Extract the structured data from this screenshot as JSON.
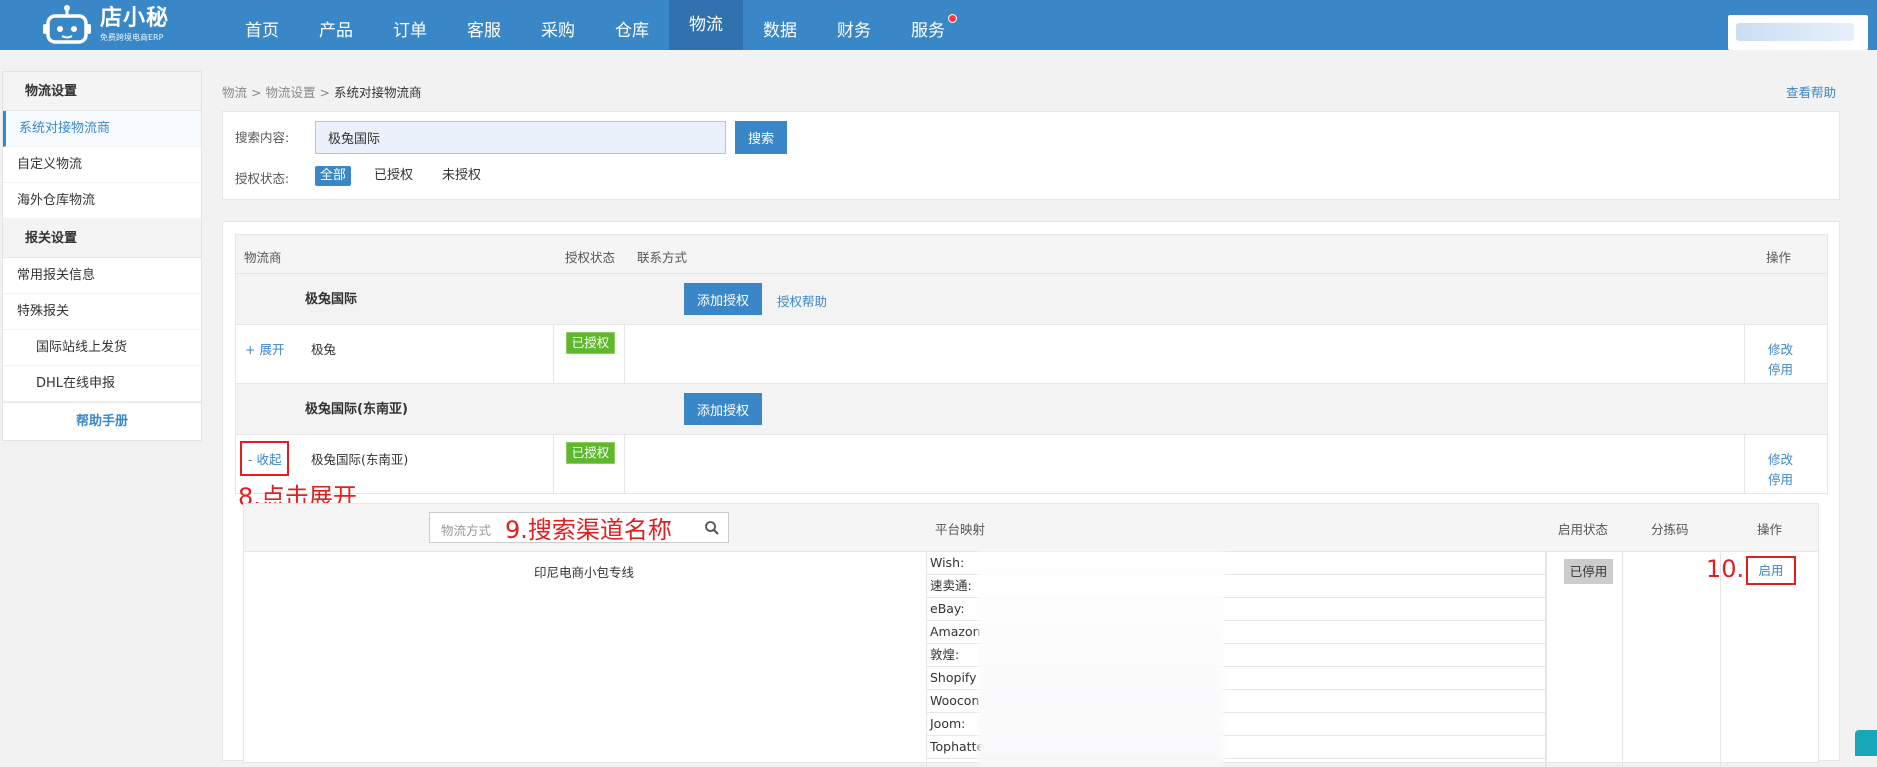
{
  "logo": {
    "name": "店小秘",
    "subtitle": "免费跨境电商ERP",
    "icon": "robot-logo-icon"
  },
  "nav": {
    "items": [
      {
        "label": "首页"
      },
      {
        "label": "产品"
      },
      {
        "label": "订单"
      },
      {
        "label": "客服"
      },
      {
        "label": "采购"
      },
      {
        "label": "仓库"
      },
      {
        "label": "物流",
        "active": true
      },
      {
        "label": "数据"
      },
      {
        "label": "财务"
      },
      {
        "label": "服务",
        "notification_dot": true
      }
    ],
    "accent": "#3a87c8"
  },
  "sidebar": {
    "group1": "物流设置",
    "items1": [
      "系统对接物流商",
      "自定义物流",
      "海外仓库物流"
    ],
    "group2": "报关设置",
    "items2": [
      "常用报关信息",
      "特殊报关",
      "国际站线上发货",
      "DHL在线申报"
    ],
    "help": "帮助手册"
  },
  "breadcrumb": {
    "a": "物流",
    "sep": ">",
    "b": "物流设置",
    "c": "系统对接物流商"
  },
  "help_link": "查看帮助",
  "search": {
    "label": "搜索内容:",
    "value": "极兔国际",
    "button": "搜索",
    "status_label": "授权状态:",
    "filters": [
      "全部",
      "已授权",
      "未授权"
    ]
  },
  "table": {
    "headers": {
      "carrier": "物流商",
      "auth": "授权状态",
      "contact": "联系方式",
      "ops": "操作"
    },
    "groups": [
      {
        "name": "极兔国际",
        "add_auth": "添加授权",
        "auth_help": "授权帮助",
        "row": {
          "toggle": "+ 展开",
          "name": "极兔",
          "status": "已授权",
          "edit": "修改",
          "disable": "停用"
        }
      },
      {
        "name": "极兔国际(东南亚)",
        "add_auth": "添加授权",
        "row": {
          "toggle": "- 收起",
          "name": "极兔国际(东南亚)",
          "status": "已授权",
          "edit": "修改",
          "disable": "停用"
        }
      }
    ]
  },
  "annotations": {
    "a8": "8.点击展开",
    "a9": "9.搜索渠道名称",
    "a10": "10."
  },
  "channels": {
    "search_placeholder": "物流方式",
    "headers": {
      "mapping": "平台映射",
      "status": "启用状态",
      "sort_code": "分拣码",
      "ops": "操作"
    },
    "row": {
      "name": "印尼电商小包专线",
      "platforms": [
        "Wish:",
        "速卖通:",
        "eBay:",
        "Amazon",
        "敦煌:",
        "Shopify",
        "Woocon",
        "Joom:",
        "Tophatte"
      ],
      "status": "已停用",
      "action": "启用"
    }
  },
  "colors": {
    "success": "#5eb82e",
    "annotation": "#e02020",
    "link": "#3a87c8"
  }
}
